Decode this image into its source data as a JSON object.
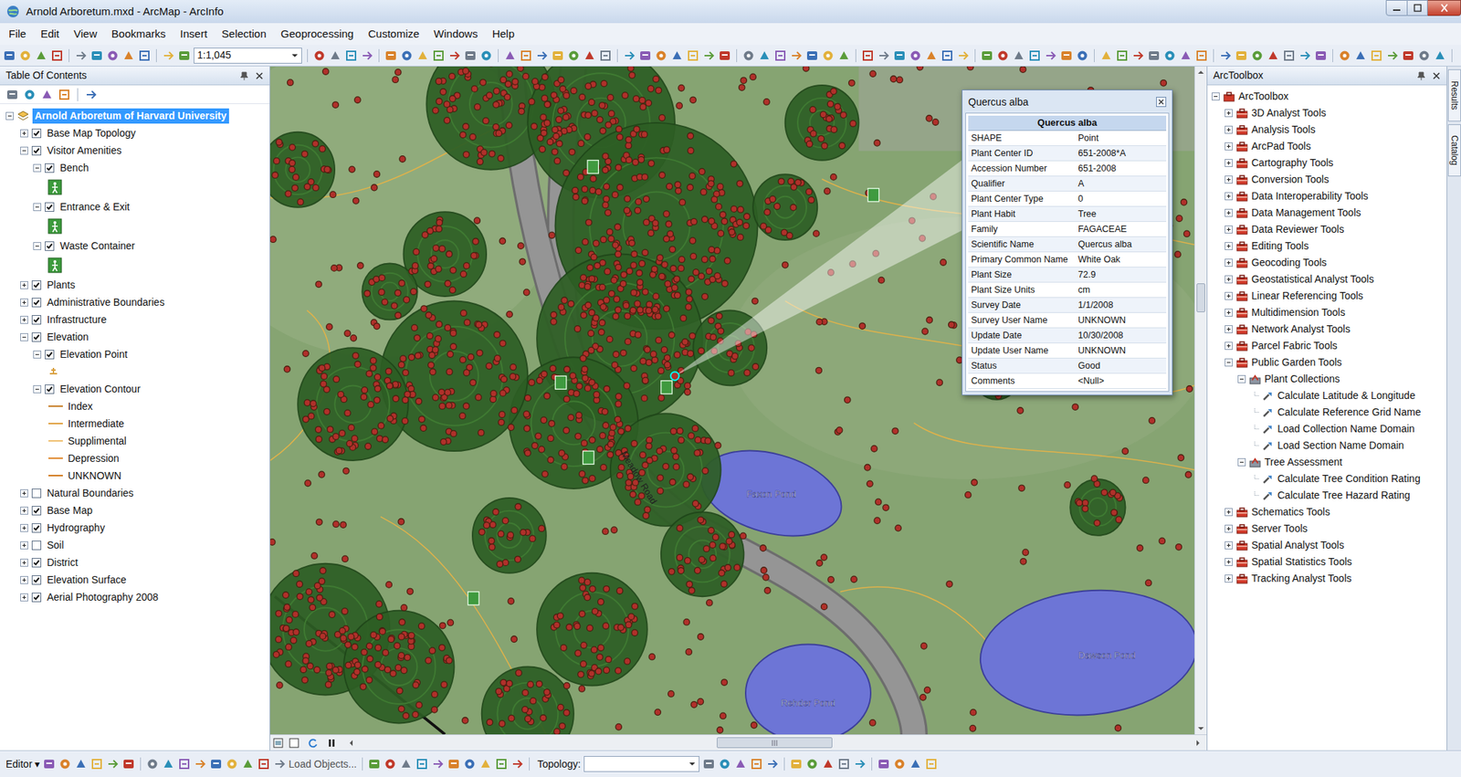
{
  "window": {
    "title": "Arnold Arboretum.mxd - ArcMap - ArcInfo"
  },
  "menu": [
    "File",
    "Edit",
    "View",
    "Bookmarks",
    "Insert",
    "Selection",
    "Geoprocessing",
    "Customize",
    "Windows",
    "Help"
  ],
  "toolbar": {
    "scale": "1:1,045"
  },
  "toc": {
    "title": "Table Of Contents",
    "root": {
      "label": "Arnold Arboretum of Harvard University",
      "expanded": true,
      "selected": true,
      "children": [
        {
          "label": "Base Map Topology",
          "checked": true,
          "expanded": false,
          "selected": false
        },
        {
          "label": "Visitor Amenities",
          "checked": true,
          "expanded": true,
          "selected": false,
          "children": [
            {
              "label": "Bench",
              "checked": true,
              "expanded": true,
              "selected": false,
              "legend": [
                {
                  "kind": "symbol",
                  "color": "#3c9a3c"
                }
              ]
            },
            {
              "label": "Entrance & Exit",
              "checked": true,
              "expanded": true,
              "selected": false,
              "legend": [
                {
                  "kind": "symbol",
                  "color": "#3c9a3c"
                }
              ]
            },
            {
              "label": "Waste Container",
              "checked": true,
              "expanded": true,
              "selected": false,
              "legend": [
                {
                  "kind": "symbol",
                  "color": "#3c9a3c"
                }
              ]
            }
          ]
        },
        {
          "label": "Plants",
          "checked": true,
          "expanded": false,
          "selected": false
        },
        {
          "label": "Administrative Boundaries",
          "checked": true,
          "expanded": false,
          "selected": false
        },
        {
          "label": "Infrastructure",
          "checked": true,
          "expanded": false,
          "selected": false
        },
        {
          "label": "Elevation",
          "checked": true,
          "expanded": true,
          "selected": false,
          "children": [
            {
              "label": "Elevation Point",
              "checked": true,
              "expanded": true,
              "selected": false,
              "legend": [
                {
                  "kind": "marker",
                  "color": "#d9a040"
                }
              ]
            },
            {
              "label": "Elevation Contour",
              "checked": true,
              "expanded": true,
              "selected": false,
              "legend": [
                {
                  "kind": "line",
                  "label": "Index",
                  "color": "#c8802a"
                },
                {
                  "kind": "line",
                  "label": "Intermediate",
                  "color": "#e0a040"
                },
                {
                  "kind": "line",
                  "label": "Supplimental",
                  "color": "#f0c070"
                },
                {
                  "kind": "line",
                  "label": "Depression",
                  "color": "#e08a30"
                },
                {
                  "kind": "line",
                  "label": "UNKNOWN",
                  "color": "#d27a1e"
                }
              ]
            }
          ]
        },
        {
          "label": "Natural Boundaries",
          "checked": false,
          "expanded": false,
          "selected": false
        },
        {
          "label": "Base Map",
          "checked": true,
          "expanded": false,
          "selected": false
        },
        {
          "label": "Hydrography",
          "checked": true,
          "expanded": false,
          "selected": false
        },
        {
          "label": "Soil",
          "checked": false,
          "expanded": false,
          "selected": false
        },
        {
          "label": "District",
          "checked": true,
          "expanded": false,
          "selected": false
        },
        {
          "label": "Elevation Surface",
          "checked": true,
          "expanded": false,
          "selected": false
        },
        {
          "label": "Aerial Photography 2008",
          "checked": true,
          "expanded": false,
          "selected": false
        }
      ]
    }
  },
  "map": {
    "ponds": [
      "Faxon Pond",
      "Rehder Pond",
      "Dawson Pond"
    ],
    "road_label": "Meadow Road",
    "popup": {
      "title": "Quercus alba",
      "header": "Quercus alba",
      "rows": [
        [
          "SHAPE",
          "Point"
        ],
        [
          "Plant Center ID",
          "651-2008*A"
        ],
        [
          "Accession Number",
          "651-2008"
        ],
        [
          "Qualifier",
          "A"
        ],
        [
          "Plant Center Type",
          "0"
        ],
        [
          "Plant Habit",
          "Tree"
        ],
        [
          "Family",
          "FAGACEAE"
        ],
        [
          "Scientific Name",
          "Quercus alba"
        ],
        [
          "Primary Common Name",
          "White Oak"
        ],
        [
          "Plant Size",
          "72.9"
        ],
        [
          "Plant Size Units",
          "cm"
        ],
        [
          "Survey Date",
          "1/1/2008"
        ],
        [
          "Survey User Name",
          "UNKNOWN"
        ],
        [
          "Update Date",
          "10/30/2008"
        ],
        [
          "Update User Name",
          "UNKNOWN"
        ],
        [
          "Status",
          "Good"
        ],
        [
          "Comments",
          "<Null>"
        ]
      ]
    }
  },
  "toolbox": {
    "title": "ArcToolbox",
    "root": {
      "label": "ArcToolbox",
      "kind": "root",
      "expanded": true,
      "children": [
        {
          "label": "3D Analyst Tools",
          "kind": "toolbox",
          "expanded": false
        },
        {
          "label": "Analysis Tools",
          "kind": "toolbox",
          "expanded": false
        },
        {
          "label": "ArcPad Tools",
          "kind": "toolbox",
          "expanded": false
        },
        {
          "label": "Cartography Tools",
          "kind": "toolbox",
          "expanded": false
        },
        {
          "label": "Conversion Tools",
          "kind": "toolbox",
          "expanded": false
        },
        {
          "label": "Data Interoperability Tools",
          "kind": "toolbox",
          "expanded": false
        },
        {
          "label": "Data Management Tools",
          "kind": "toolbox",
          "expanded": false
        },
        {
          "label": "Data Reviewer Tools",
          "kind": "toolbox",
          "expanded": false
        },
        {
          "label": "Editing Tools",
          "kind": "toolbox",
          "expanded": false
        },
        {
          "label": "Geocoding Tools",
          "kind": "toolbox",
          "expanded": false
        },
        {
          "label": "Geostatistical Analyst Tools",
          "kind": "toolbox",
          "expanded": false
        },
        {
          "label": "Linear Referencing Tools",
          "kind": "toolbox",
          "expanded": false
        },
        {
          "label": "Multidimension Tools",
          "kind": "toolbox",
          "expanded": false
        },
        {
          "label": "Network Analyst Tools",
          "kind": "toolbox",
          "expanded": false
        },
        {
          "label": "Parcel Fabric Tools",
          "kind": "toolbox",
          "expanded": false
        },
        {
          "label": "Public Garden Tools",
          "kind": "toolbox",
          "expanded": true,
          "children": [
            {
              "label": "Plant Collections",
              "kind": "toolset",
              "expanded": true,
              "children": [
                {
                  "label": "Calculate Latitude & Longitude",
                  "kind": "tool"
                },
                {
                  "label": "Calculate Reference Grid Name",
                  "kind": "tool"
                },
                {
                  "label": "Load Collection Name Domain",
                  "kind": "tool"
                },
                {
                  "label": "Load Section Name Domain",
                  "kind": "tool"
                }
              ]
            },
            {
              "label": "Tree Assessment",
              "kind": "toolset",
              "expanded": true,
              "children": [
                {
                  "label": "Calculate Tree Condition Rating",
                  "kind": "tool"
                },
                {
                  "label": "Calculate Tree Hazard Rating",
                  "kind": "tool"
                }
              ]
            }
          ]
        },
        {
          "label": "Schematics Tools",
          "kind": "toolbox",
          "expanded": false
        },
        {
          "label": "Server Tools",
          "kind": "toolbox",
          "expanded": false
        },
        {
          "label": "Spatial Analyst Tools",
          "kind": "toolbox",
          "expanded": false
        },
        {
          "label": "Spatial Statistics Tools",
          "kind": "toolbox",
          "expanded": false
        },
        {
          "label": "Tracking Analyst Tools",
          "kind": "toolbox",
          "expanded": false
        }
      ]
    }
  },
  "side_tabs": [
    "Results",
    "Catalog"
  ],
  "editor_bar": {
    "editor": "Editor",
    "caret": "▾",
    "load_objects": "Load Objects...",
    "topology": "Topology:"
  }
}
